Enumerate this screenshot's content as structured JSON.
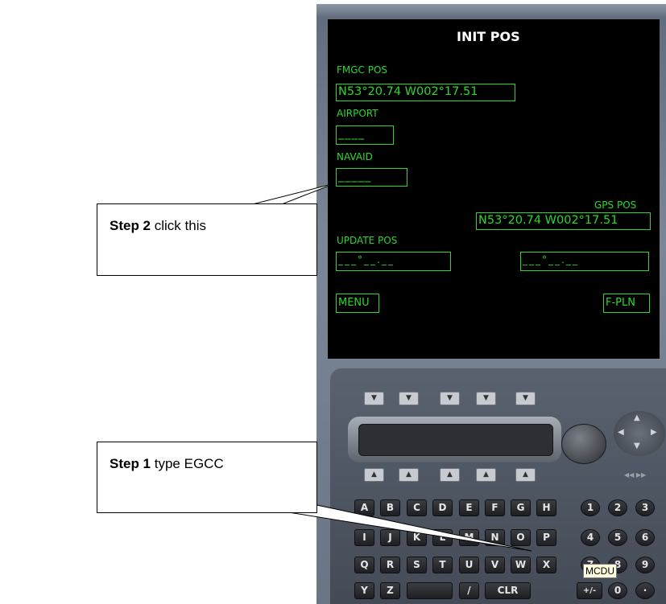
{
  "screen": {
    "title": "INIT POS",
    "fmgc_pos_label": "FMGC POS",
    "fmgc_pos_value": "N53°20.74 W002°17.51",
    "airport_label": "AIRPORT",
    "airport_value": "____",
    "navaid_label": "NAVAID",
    "navaid_value": "_____",
    "gps_pos_label": "GPS POS",
    "gps_pos_value": "N53°20.74 W002°17.51",
    "update_pos_label": "UPDATE POS",
    "update_left_value": "___°__.__",
    "update_right_value": "___°__.__",
    "menu_label": "MENU",
    "fpln_label": "F-PLN"
  },
  "keypad": {
    "select_down_glyph": "▼",
    "select_up_glyph": "▲",
    "nav_arrows": [
      "▲",
      "▼",
      "◀",
      "▶"
    ],
    "page_arrows": "◀◀  ▶▶",
    "letter_rows": [
      [
        "A",
        "B",
        "C",
        "D",
        "E",
        "F",
        "G",
        "H"
      ],
      [
        "I",
        "J",
        "K",
        "L",
        "M",
        "N",
        "O",
        "P"
      ],
      [
        "Q",
        "R",
        "S",
        "T",
        "U",
        "V",
        "W",
        "X"
      ],
      [
        "Y",
        "Z",
        "",
        "/",
        "CLR"
      ]
    ],
    "number_rows": [
      [
        "1",
        "2",
        "3"
      ],
      [
        "4",
        "5",
        "6"
      ],
      [
        "7",
        "8",
        "9"
      ],
      [
        "+/-",
        "0",
        "·"
      ]
    ],
    "mcdu_label": "MCDU"
  },
  "callouts": {
    "step2": {
      "bold": "Step 2",
      "text": " click this"
    },
    "step1": {
      "bold": "Step 1",
      "text": " type EGCC"
    }
  },
  "colors": {
    "screen_text": "#2fd62f",
    "screen_bg": "#000000",
    "bezel": "#6a7584"
  }
}
